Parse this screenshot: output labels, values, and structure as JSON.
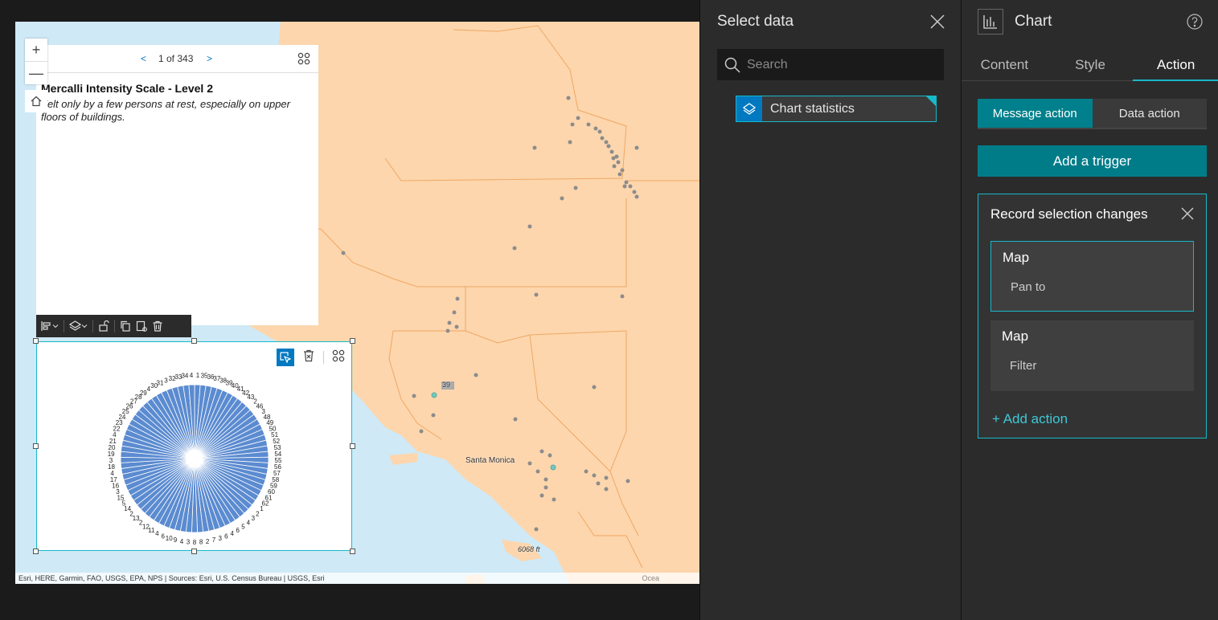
{
  "map": {
    "attribution": "Esri, HERE, Garmin, FAO, USGS, EPA, NPS | Sources: Esri, U.S. Census Bureau | USGS, Esri",
    "attribution_right": "Ocea",
    "labels": {
      "santa_monica": "Santa Monica",
      "highway": "39",
      "elevation": "6068 ft"
    },
    "land_color": "#fdd6ad",
    "water_color": "#cfe9f6",
    "border_color": "#f0a764",
    "point_color": "#8c8c8c",
    "selected_point_color": "#73c9c0"
  },
  "zoom": {
    "in_label": "+",
    "out_label": "—"
  },
  "popup": {
    "prev": "<",
    "next": ">",
    "pager": "1 of 343",
    "title": "Mercalli Intensity Scale -  Level 2",
    "description": "Felt only by a few persons at rest, especially on upper floors of buildings."
  },
  "chart_widget": {
    "color": "#5b8bd0",
    "chart_data": {
      "type": "pie",
      "labels": [
        "1",
        "35",
        "36",
        "37",
        "38",
        "39",
        "40",
        "41",
        "42",
        "43",
        "2",
        "46",
        "3",
        "48",
        "49",
        "50",
        "51",
        "52",
        "53",
        "54",
        "55",
        "56",
        "57",
        "58",
        "59",
        "60",
        "61",
        "62",
        "1",
        "2",
        "3",
        "4",
        "5",
        "6",
        "4",
        "6",
        "3",
        "7",
        "2",
        "8",
        "8",
        "3",
        "4",
        "9",
        "10",
        "6",
        "4",
        "11",
        "12",
        "2",
        "13",
        "2",
        "14",
        "5",
        "15",
        "3",
        "16",
        "17",
        "4",
        "18",
        "3",
        "19",
        "20",
        "21",
        "4",
        "22",
        "23",
        "24",
        "25",
        "26",
        "27",
        "28",
        "29",
        "4",
        "30",
        "31",
        "3",
        "32",
        "33",
        "34",
        "4"
      ]
    }
  },
  "select_data": {
    "title": "Select data",
    "search_placeholder": "Search",
    "item_label": "Chart statistics"
  },
  "settings": {
    "title": "Chart",
    "tabs": [
      "Content",
      "Style",
      "Action"
    ],
    "segments": [
      "Message action",
      "Data action"
    ],
    "add_trigger": "Add a trigger",
    "trigger_title": "Record selection changes",
    "actions": [
      {
        "target": "Map",
        "name": "Pan to"
      },
      {
        "target": "Map",
        "name": "Filter"
      }
    ],
    "add_action": "+ Add action",
    "accent": "#16b9c9"
  }
}
